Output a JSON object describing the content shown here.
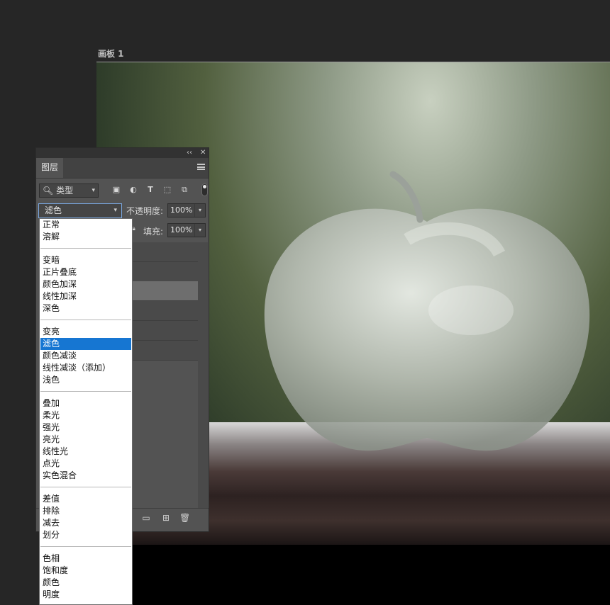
{
  "artboard": {
    "title": "画板 1"
  },
  "layers_panel": {
    "collapse_label": "‹‹",
    "close_label": "✕",
    "tab_label": "图层",
    "filter": {
      "label": "类型"
    },
    "blend_mode": {
      "selected": "滤色"
    },
    "opacity": {
      "label": "不透明度:",
      "value": "100%"
    },
    "fill": {
      "label": "填充:",
      "value": "100%"
    }
  },
  "blend_menu": {
    "groups": [
      [
        "正常",
        "溶解"
      ],
      [
        "变暗",
        "正片叠底",
        "颜色加深",
        "线性加深",
        "深色"
      ],
      [
        "变亮",
        "滤色",
        "颜色减淡",
        "线性减淡（添加）",
        "浅色"
      ],
      [
        "叠加",
        "柔光",
        "强光",
        "亮光",
        "线性光",
        "点光",
        "实色混合"
      ],
      [
        "差值",
        "排除",
        "减去",
        "划分"
      ],
      [
        "色相",
        "饱和度",
        "颜色",
        "明度"
      ]
    ],
    "selected": "滤色"
  },
  "icons": {
    "filter_search": "search-icon",
    "image_filter": "image-icon",
    "adjustment_filter": "adjustment-icon",
    "type_filter": "type-icon",
    "shape_filter": "shape-icon",
    "smart_object_filter": "smart-object-icon",
    "folder": "folder-icon",
    "new_layer": "new-layer-icon",
    "delete": "trash-icon"
  },
  "colors": {
    "selection": "#1676d2",
    "panel": "#535353",
    "workspace": "#262626"
  }
}
